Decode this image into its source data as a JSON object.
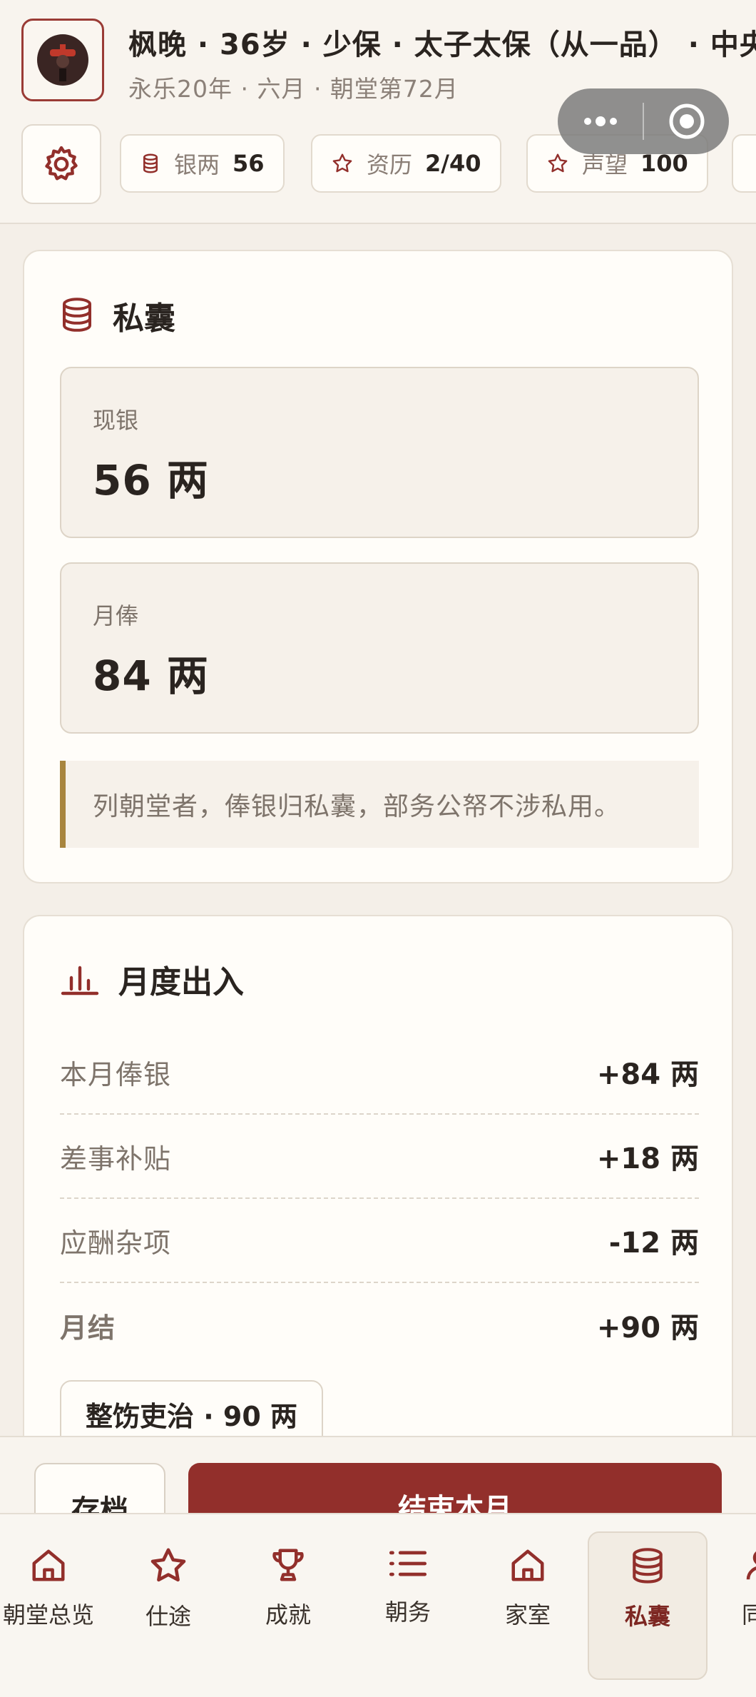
{
  "header": {
    "title": "枫晚 · 36岁 · 少保 · 太子太保（从一品） · 中央",
    "subtitle": "永乐20年 · 六月 · 朝堂第72月",
    "stats": [
      {
        "label": "银两",
        "value": "56",
        "icon": "coin-stack-icon"
      },
      {
        "label": "资历",
        "value": "2/40",
        "icon": "star-icon"
      },
      {
        "label": "声望",
        "value": "100",
        "icon": "star-icon"
      }
    ]
  },
  "purse": {
    "title": "私囊",
    "cash_label": "现银",
    "cash_value": "56 两",
    "salary_label": "月俸",
    "salary_value": "84 两",
    "note": "列朝堂者，俸银归私囊，部务公帑不涉私用。"
  },
  "monthly": {
    "title": "月度出入",
    "rows": [
      {
        "label": "本月俸银",
        "value": "+84 两"
      },
      {
        "label": "差事补贴",
        "value": "+18 两"
      },
      {
        "label": "应酬杂项",
        "value": "-12 两"
      },
      {
        "label": "月结",
        "value": "+90 两"
      }
    ],
    "pill": "整饬吏治 · 90 两"
  },
  "actions": {
    "save": "存档",
    "end_month": "结束本月"
  },
  "nav": [
    {
      "label": "朝堂总览",
      "icon": "home-icon"
    },
    {
      "label": "仕途",
      "icon": "star-icon"
    },
    {
      "label": "成就",
      "icon": "trophy-icon"
    },
    {
      "label": "朝务",
      "icon": "list-icon"
    },
    {
      "label": "家室",
      "icon": "home-icon"
    },
    {
      "label": "私囊",
      "icon": "coin-stack-icon",
      "active": true
    },
    {
      "label": "同",
      "icon": "person-icon"
    }
  ],
  "colors": {
    "accent": "#922f2b",
    "gold": "#a8853e",
    "background": "#f4efe8",
    "card": "#fffdf9"
  }
}
